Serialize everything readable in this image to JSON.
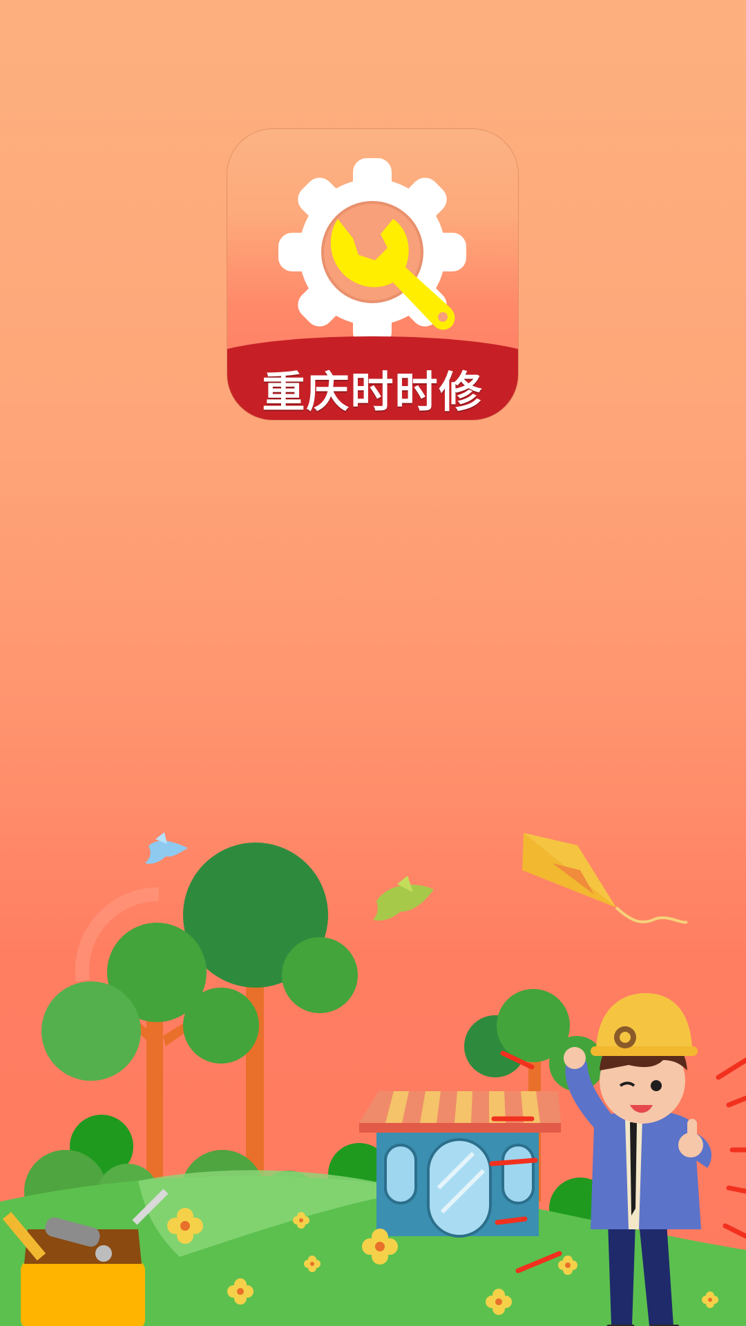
{
  "app": {
    "icon_name": "settings-wrench-icon",
    "title": "重庆时时修"
  },
  "colors": {
    "background_top": "#FDB07E",
    "background_bottom": "#FF7A60",
    "banner_red": "#C62026",
    "wrench_yellow": "#FFEE00",
    "grass_green": "#5CC04E"
  },
  "illustration": {
    "elements": [
      "trees",
      "birds",
      "kite",
      "shop",
      "worker-mascot",
      "toolbox",
      "flowers"
    ]
  }
}
